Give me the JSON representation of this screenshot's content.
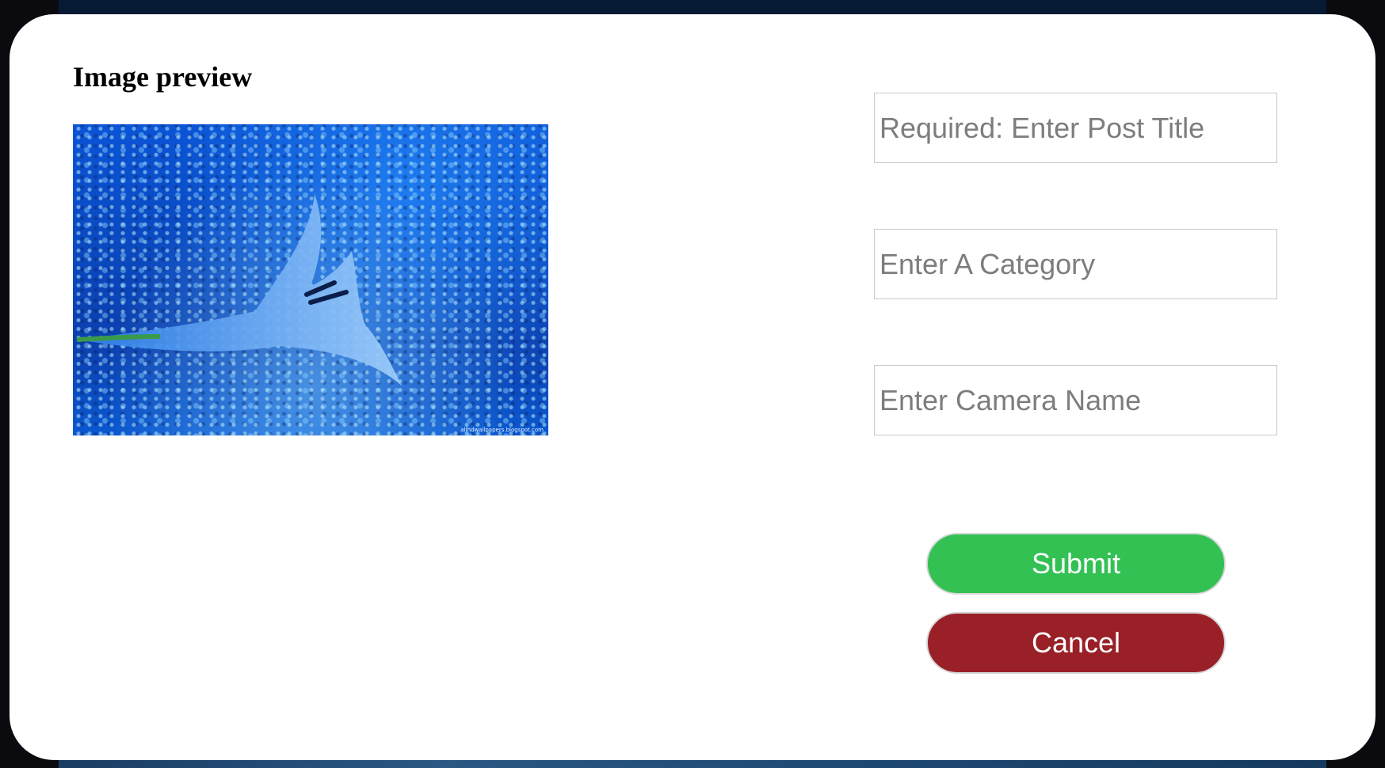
{
  "modal": {
    "preview_title": "Image preview",
    "preview_image": {
      "description_icon": "photo",
      "credit_text": "allhdwallpapers.blogspot.com"
    }
  },
  "form": {
    "title_field": {
      "placeholder": "Required: Enter Post Title",
      "value": ""
    },
    "category_field": {
      "placeholder": "Enter A Category",
      "value": ""
    },
    "camera_field": {
      "placeholder": "Enter Camera Name",
      "value": ""
    },
    "submit_label": "Submit",
    "cancel_label": "Cancel"
  },
  "colors": {
    "submit": "#33c154",
    "cancel": "#9a2028",
    "backdrop": "#0b2547"
  }
}
